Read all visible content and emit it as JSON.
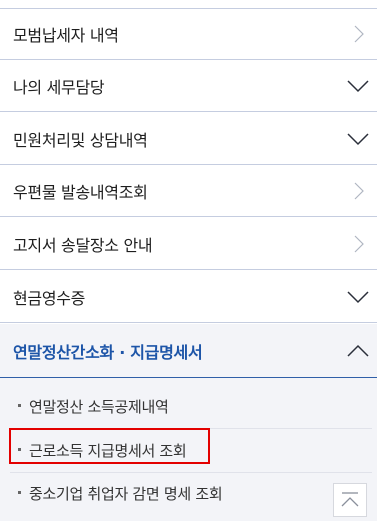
{
  "menu": {
    "items": [
      {
        "label": "모범납세자 내역",
        "icon": "chevron-right-icon"
      },
      {
        "label": "나의 세무담당",
        "icon": "chevron-down-icon"
      },
      {
        "label": "민원처리및 상담내역",
        "icon": "chevron-down-icon"
      },
      {
        "label": "우편물 발송내역조회",
        "icon": "chevron-right-icon"
      },
      {
        "label": "고지서 송달장소 안내",
        "icon": "chevron-right-icon"
      },
      {
        "label": "현금영수증",
        "icon": "chevron-down-icon"
      },
      {
        "label": "연말정산간소화 · 지급명세서",
        "icon": "chevron-up-icon"
      }
    ]
  },
  "submenu": {
    "items": [
      {
        "label": "연말정산 소득공제내역"
      },
      {
        "label": "근로소득 지급명세서 조회"
      },
      {
        "label": "중소기업 취업자 감면 명세 조회"
      }
    ]
  },
  "colors": {
    "active_text": "#1d55a8",
    "highlight_border": "#e30000",
    "divider": "#c5cde0"
  }
}
